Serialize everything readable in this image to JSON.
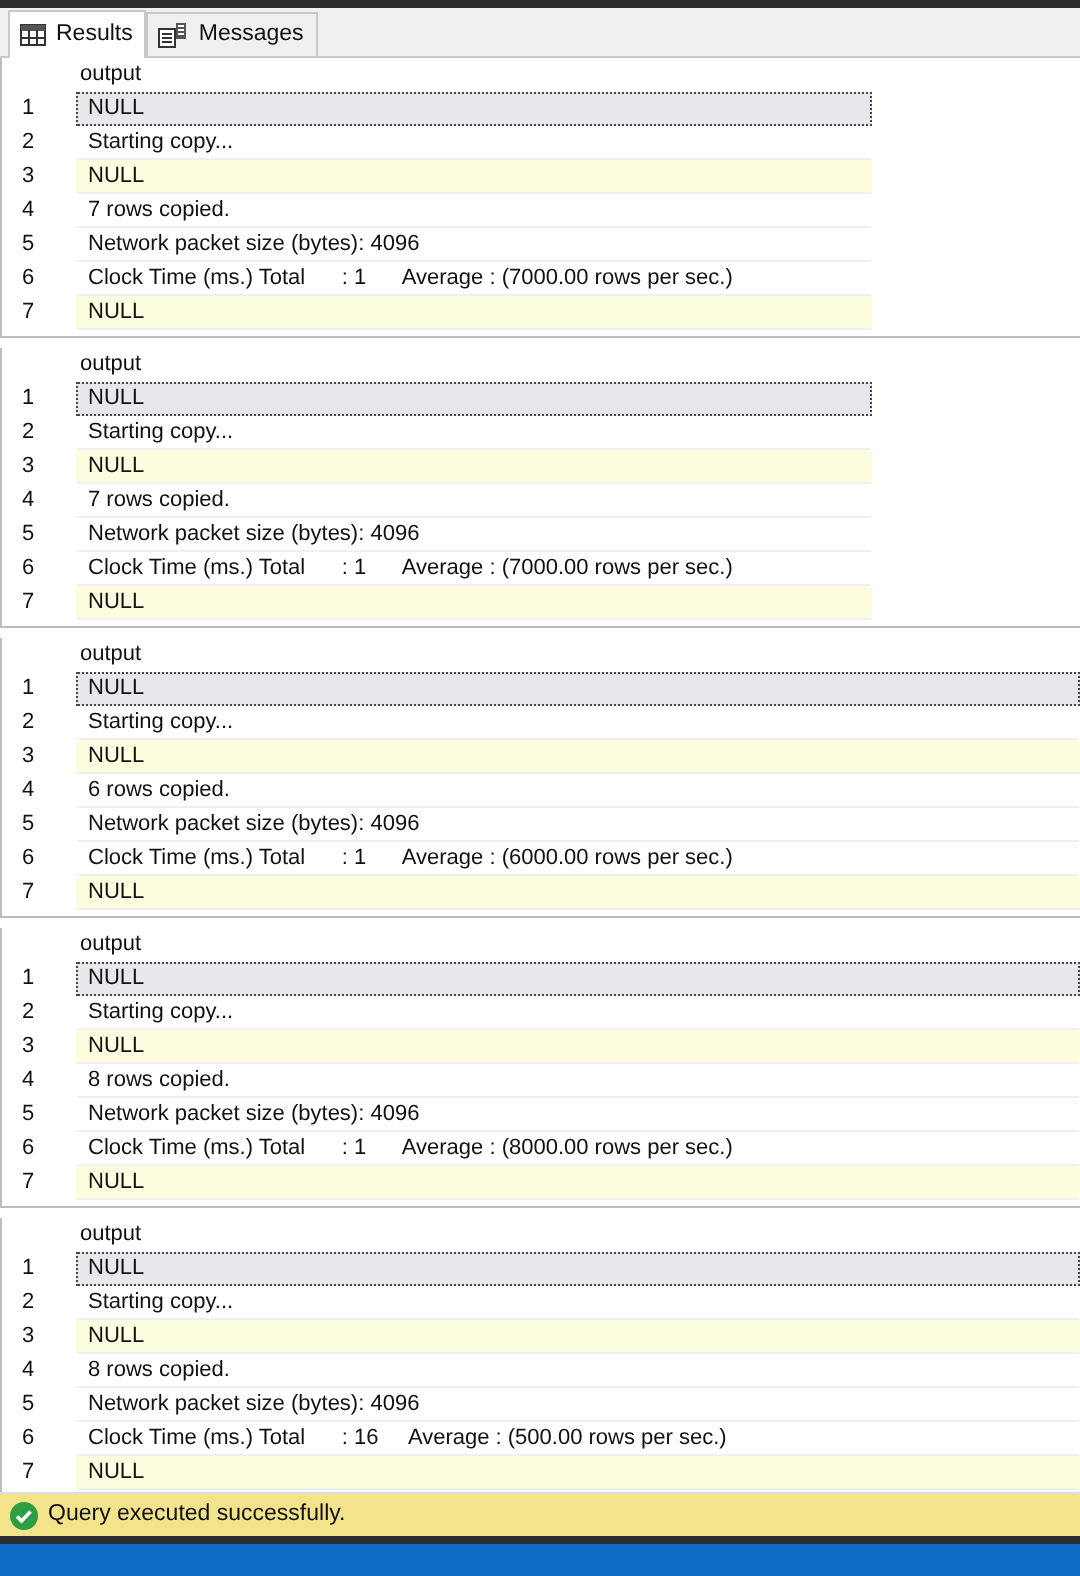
{
  "tabs": [
    {
      "label": "Results",
      "selected": true
    },
    {
      "label": "Messages",
      "selected": false
    }
  ],
  "grids": [
    {
      "fit_to_content": true,
      "columns": [
        "output"
      ],
      "rows": [
        {
          "number": "1",
          "value": "NULL",
          "selected": true,
          "highlighted": false
        },
        {
          "number": "2",
          "value": "Starting copy...",
          "selected": false,
          "highlighted": false
        },
        {
          "number": "3",
          "value": "NULL",
          "selected": false,
          "highlighted": true
        },
        {
          "number": "4",
          "value": "7 rows copied.",
          "selected": false,
          "highlighted": false
        },
        {
          "number": "5",
          "value": "Network packet size (bytes): 4096",
          "selected": false,
          "highlighted": false
        },
        {
          "number": "6",
          "value": "Clock Time (ms.) Total      : 1      Average : (7000.00 rows per sec.)",
          "selected": false,
          "highlighted": false
        },
        {
          "number": "7",
          "value": "NULL",
          "selected": false,
          "highlighted": true
        }
      ]
    },
    {
      "fit_to_content": true,
      "columns": [
        "output"
      ],
      "rows": [
        {
          "number": "1",
          "value": "NULL",
          "selected": true,
          "highlighted": false
        },
        {
          "number": "2",
          "value": "Starting copy...",
          "selected": false,
          "highlighted": false
        },
        {
          "number": "3",
          "value": "NULL",
          "selected": false,
          "highlighted": true
        },
        {
          "number": "4",
          "value": "7 rows copied.",
          "selected": false,
          "highlighted": false
        },
        {
          "number": "5",
          "value": "Network packet size (bytes): 4096",
          "selected": false,
          "highlighted": false
        },
        {
          "number": "6",
          "value": "Clock Time (ms.) Total      : 1      Average : (7000.00 rows per sec.)",
          "selected": false,
          "highlighted": false
        },
        {
          "number": "7",
          "value": "NULL",
          "selected": false,
          "highlighted": true
        }
      ]
    },
    {
      "fit_to_content": false,
      "columns": [
        "output"
      ],
      "rows": [
        {
          "number": "1",
          "value": "NULL",
          "selected": true,
          "highlighted": false
        },
        {
          "number": "2",
          "value": "Starting copy...",
          "selected": false,
          "highlighted": false
        },
        {
          "number": "3",
          "value": "NULL",
          "selected": false,
          "highlighted": true
        },
        {
          "number": "4",
          "value": "6 rows copied.",
          "selected": false,
          "highlighted": false
        },
        {
          "number": "5",
          "value": "Network packet size (bytes): 4096",
          "selected": false,
          "highlighted": false
        },
        {
          "number": "6",
          "value": "Clock Time (ms.) Total      : 1      Average : (6000.00 rows per sec.)",
          "selected": false,
          "highlighted": false
        },
        {
          "number": "7",
          "value": "NULL",
          "selected": false,
          "highlighted": true
        }
      ]
    },
    {
      "fit_to_content": false,
      "columns": [
        "output"
      ],
      "rows": [
        {
          "number": "1",
          "value": "NULL",
          "selected": true,
          "highlighted": false
        },
        {
          "number": "2",
          "value": "Starting copy...",
          "selected": false,
          "highlighted": false
        },
        {
          "number": "3",
          "value": "NULL",
          "selected": false,
          "highlighted": true
        },
        {
          "number": "4",
          "value": "8 rows copied.",
          "selected": false,
          "highlighted": false
        },
        {
          "number": "5",
          "value": "Network packet size (bytes): 4096",
          "selected": false,
          "highlighted": false
        },
        {
          "number": "6",
          "value": "Clock Time (ms.) Total      : 1      Average : (8000.00 rows per sec.)",
          "selected": false,
          "highlighted": false
        },
        {
          "number": "7",
          "value": "NULL",
          "selected": false,
          "highlighted": true
        }
      ]
    },
    {
      "fit_to_content": false,
      "columns": [
        "output"
      ],
      "rows": [
        {
          "number": "1",
          "value": "NULL",
          "selected": true,
          "highlighted": false
        },
        {
          "number": "2",
          "value": "Starting copy...",
          "selected": false,
          "highlighted": false
        },
        {
          "number": "3",
          "value": "NULL",
          "selected": false,
          "highlighted": true
        },
        {
          "number": "4",
          "value": "8 rows copied.",
          "selected": false,
          "highlighted": false
        },
        {
          "number": "5",
          "value": "Network packet size (bytes): 4096",
          "selected": false,
          "highlighted": false
        },
        {
          "number": "6",
          "value": "Clock Time (ms.) Total      : 16     Average : (500.00 rows per sec.)",
          "selected": false,
          "highlighted": false
        },
        {
          "number": "7",
          "value": "NULL",
          "selected": false,
          "highlighted": true
        }
      ]
    }
  ],
  "status_bar": {
    "text": "Query executed successfully."
  }
}
